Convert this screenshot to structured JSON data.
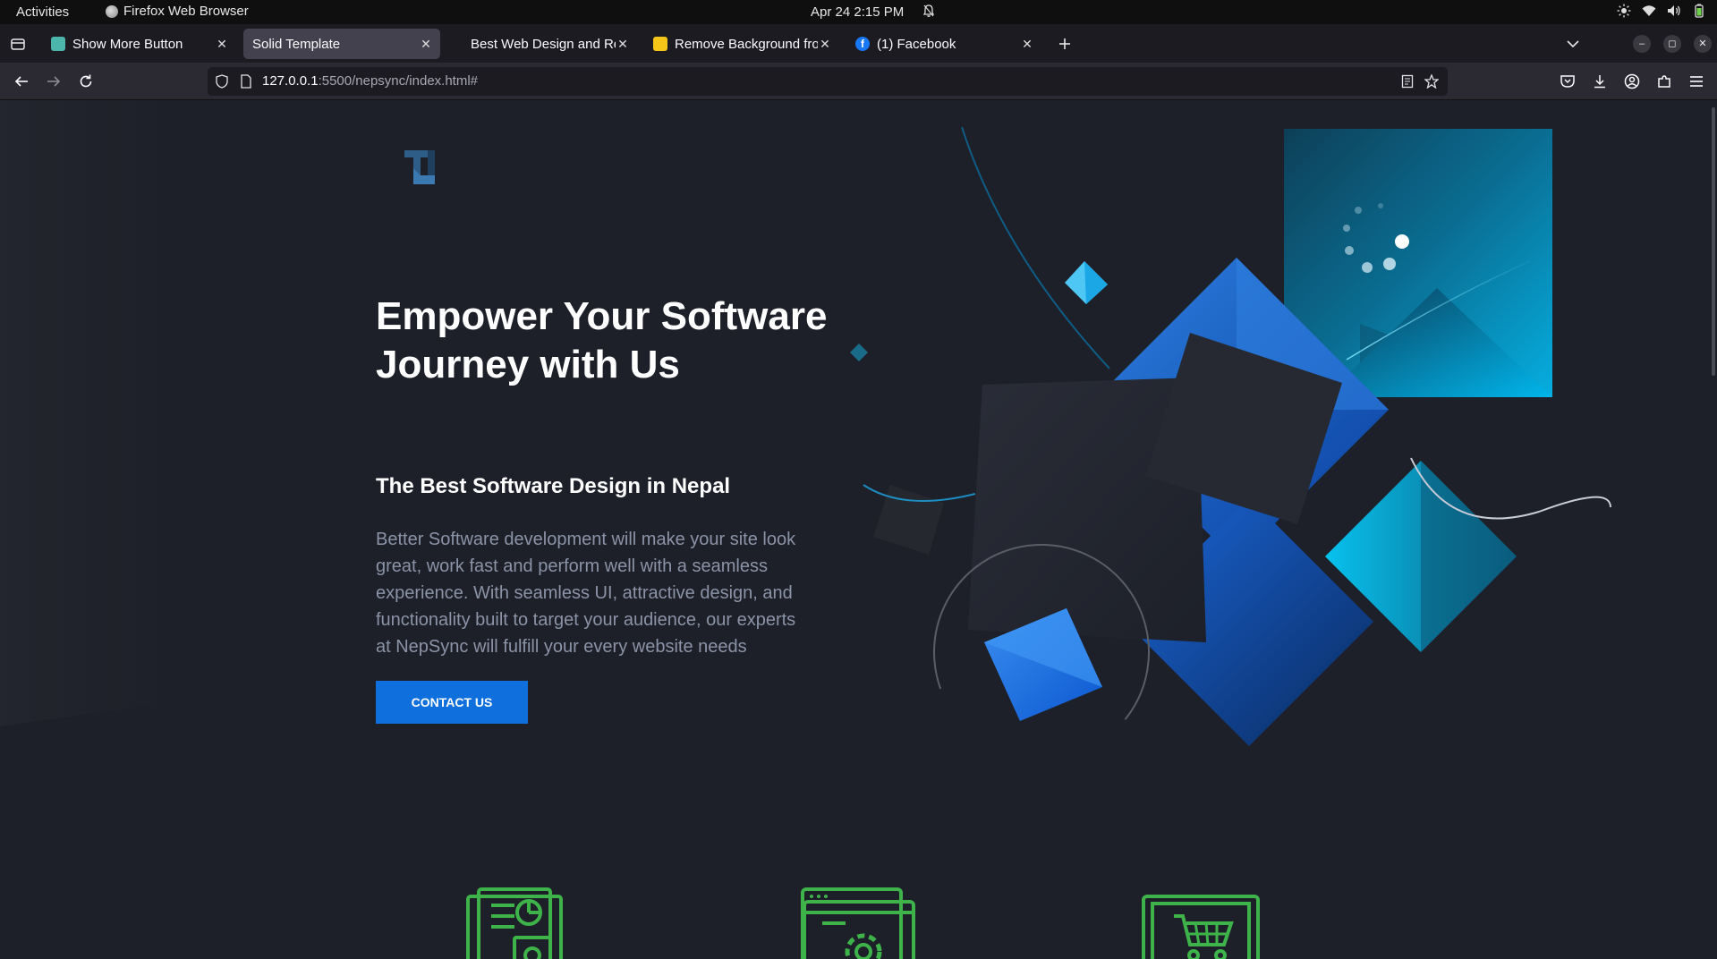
{
  "system": {
    "activities": "Activities",
    "app_name": "Firefox Web Browser",
    "clock": "Apr 24  2:15 PM"
  },
  "tabs": [
    {
      "title": "Show More Button",
      "favicon": "page-icon",
      "active": false
    },
    {
      "title": "Solid Template",
      "favicon": "none",
      "active": true
    },
    {
      "title": "Best Web Design and Re",
      "favicon": "none",
      "active": false
    },
    {
      "title": "Remove Background fro",
      "favicon": "yellow-logo-icon",
      "active": false
    },
    {
      "title": "(1) Facebook",
      "favicon": "facebook-icon",
      "active": false
    }
  ],
  "address": {
    "host": "127.0.0.1",
    "path": ":5500/nepsync/index.html#"
  },
  "hero": {
    "title": "Empower Your Software Journey with Us",
    "subtitle": "The Best Software Design in Nepal",
    "description": "Better Software development will make your site look great, work fast and perform well with a seamless experience. With seamless UI, attractive design, and functionality built to target your audience, our experts at NepSync will fulfill your every website needs",
    "cta": "CONTACT US"
  },
  "features": [
    {
      "icon": "analytics-report-icon"
    },
    {
      "icon": "web-settings-gear-icon"
    },
    {
      "icon": "shopping-cart-icon"
    }
  ],
  "colors": {
    "page_bg": "#1e2029",
    "accent": "#0f6fdc",
    "feature_icon": "#3db34a",
    "text_muted": "#8b93a7"
  }
}
